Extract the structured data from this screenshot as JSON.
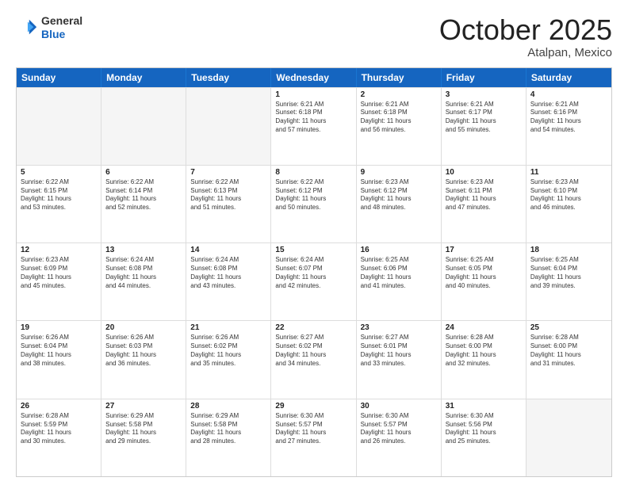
{
  "header": {
    "logo_line1": "General",
    "logo_line2": "Blue",
    "month": "October 2025",
    "location": "Atalpan, Mexico"
  },
  "weekdays": [
    "Sunday",
    "Monday",
    "Tuesday",
    "Wednesday",
    "Thursday",
    "Friday",
    "Saturday"
  ],
  "rows": [
    [
      {
        "day": "",
        "info": "",
        "empty": true
      },
      {
        "day": "",
        "info": "",
        "empty": true
      },
      {
        "day": "",
        "info": "",
        "empty": true
      },
      {
        "day": "1",
        "info": "Sunrise: 6:21 AM\nSunset: 6:18 PM\nDaylight: 11 hours\nand 57 minutes."
      },
      {
        "day": "2",
        "info": "Sunrise: 6:21 AM\nSunset: 6:18 PM\nDaylight: 11 hours\nand 56 minutes."
      },
      {
        "day": "3",
        "info": "Sunrise: 6:21 AM\nSunset: 6:17 PM\nDaylight: 11 hours\nand 55 minutes."
      },
      {
        "day": "4",
        "info": "Sunrise: 6:21 AM\nSunset: 6:16 PM\nDaylight: 11 hours\nand 54 minutes."
      }
    ],
    [
      {
        "day": "5",
        "info": "Sunrise: 6:22 AM\nSunset: 6:15 PM\nDaylight: 11 hours\nand 53 minutes."
      },
      {
        "day": "6",
        "info": "Sunrise: 6:22 AM\nSunset: 6:14 PM\nDaylight: 11 hours\nand 52 minutes."
      },
      {
        "day": "7",
        "info": "Sunrise: 6:22 AM\nSunset: 6:13 PM\nDaylight: 11 hours\nand 51 minutes."
      },
      {
        "day": "8",
        "info": "Sunrise: 6:22 AM\nSunset: 6:12 PM\nDaylight: 11 hours\nand 50 minutes."
      },
      {
        "day": "9",
        "info": "Sunrise: 6:23 AM\nSunset: 6:12 PM\nDaylight: 11 hours\nand 48 minutes."
      },
      {
        "day": "10",
        "info": "Sunrise: 6:23 AM\nSunset: 6:11 PM\nDaylight: 11 hours\nand 47 minutes."
      },
      {
        "day": "11",
        "info": "Sunrise: 6:23 AM\nSunset: 6:10 PM\nDaylight: 11 hours\nand 46 minutes."
      }
    ],
    [
      {
        "day": "12",
        "info": "Sunrise: 6:23 AM\nSunset: 6:09 PM\nDaylight: 11 hours\nand 45 minutes."
      },
      {
        "day": "13",
        "info": "Sunrise: 6:24 AM\nSunset: 6:08 PM\nDaylight: 11 hours\nand 44 minutes."
      },
      {
        "day": "14",
        "info": "Sunrise: 6:24 AM\nSunset: 6:08 PM\nDaylight: 11 hours\nand 43 minutes."
      },
      {
        "day": "15",
        "info": "Sunrise: 6:24 AM\nSunset: 6:07 PM\nDaylight: 11 hours\nand 42 minutes."
      },
      {
        "day": "16",
        "info": "Sunrise: 6:25 AM\nSunset: 6:06 PM\nDaylight: 11 hours\nand 41 minutes."
      },
      {
        "day": "17",
        "info": "Sunrise: 6:25 AM\nSunset: 6:05 PM\nDaylight: 11 hours\nand 40 minutes."
      },
      {
        "day": "18",
        "info": "Sunrise: 6:25 AM\nSunset: 6:04 PM\nDaylight: 11 hours\nand 39 minutes."
      }
    ],
    [
      {
        "day": "19",
        "info": "Sunrise: 6:26 AM\nSunset: 6:04 PM\nDaylight: 11 hours\nand 38 minutes."
      },
      {
        "day": "20",
        "info": "Sunrise: 6:26 AM\nSunset: 6:03 PM\nDaylight: 11 hours\nand 36 minutes."
      },
      {
        "day": "21",
        "info": "Sunrise: 6:26 AM\nSunset: 6:02 PM\nDaylight: 11 hours\nand 35 minutes."
      },
      {
        "day": "22",
        "info": "Sunrise: 6:27 AM\nSunset: 6:02 PM\nDaylight: 11 hours\nand 34 minutes."
      },
      {
        "day": "23",
        "info": "Sunrise: 6:27 AM\nSunset: 6:01 PM\nDaylight: 11 hours\nand 33 minutes."
      },
      {
        "day": "24",
        "info": "Sunrise: 6:28 AM\nSunset: 6:00 PM\nDaylight: 11 hours\nand 32 minutes."
      },
      {
        "day": "25",
        "info": "Sunrise: 6:28 AM\nSunset: 6:00 PM\nDaylight: 11 hours\nand 31 minutes."
      }
    ],
    [
      {
        "day": "26",
        "info": "Sunrise: 6:28 AM\nSunset: 5:59 PM\nDaylight: 11 hours\nand 30 minutes."
      },
      {
        "day": "27",
        "info": "Sunrise: 6:29 AM\nSunset: 5:58 PM\nDaylight: 11 hours\nand 29 minutes."
      },
      {
        "day": "28",
        "info": "Sunrise: 6:29 AM\nSunset: 5:58 PM\nDaylight: 11 hours\nand 28 minutes."
      },
      {
        "day": "29",
        "info": "Sunrise: 6:30 AM\nSunset: 5:57 PM\nDaylight: 11 hours\nand 27 minutes."
      },
      {
        "day": "30",
        "info": "Sunrise: 6:30 AM\nSunset: 5:57 PM\nDaylight: 11 hours\nand 26 minutes."
      },
      {
        "day": "31",
        "info": "Sunrise: 6:30 AM\nSunset: 5:56 PM\nDaylight: 11 hours\nand 25 minutes."
      },
      {
        "day": "",
        "info": "",
        "empty": true
      }
    ]
  ]
}
